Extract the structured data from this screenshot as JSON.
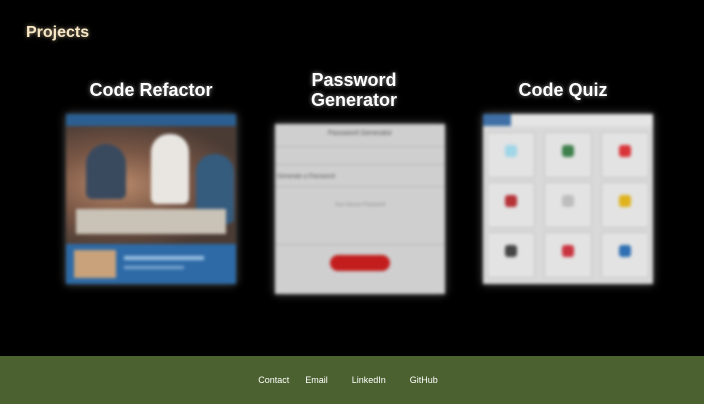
{
  "section": {
    "title": "Projects"
  },
  "projects": [
    {
      "title": "Code Refactor"
    },
    {
      "title": "Password Generator"
    },
    {
      "title": "Code Quiz"
    }
  ],
  "footer": {
    "contact_label": "Contact",
    "links": [
      "Email",
      "LinkedIn",
      "GitHub"
    ],
    "background": "#4c6130"
  },
  "colors": {
    "page_bg": "#000000",
    "title_color": "#f7e7c4",
    "card_title": "#ffffff"
  }
}
